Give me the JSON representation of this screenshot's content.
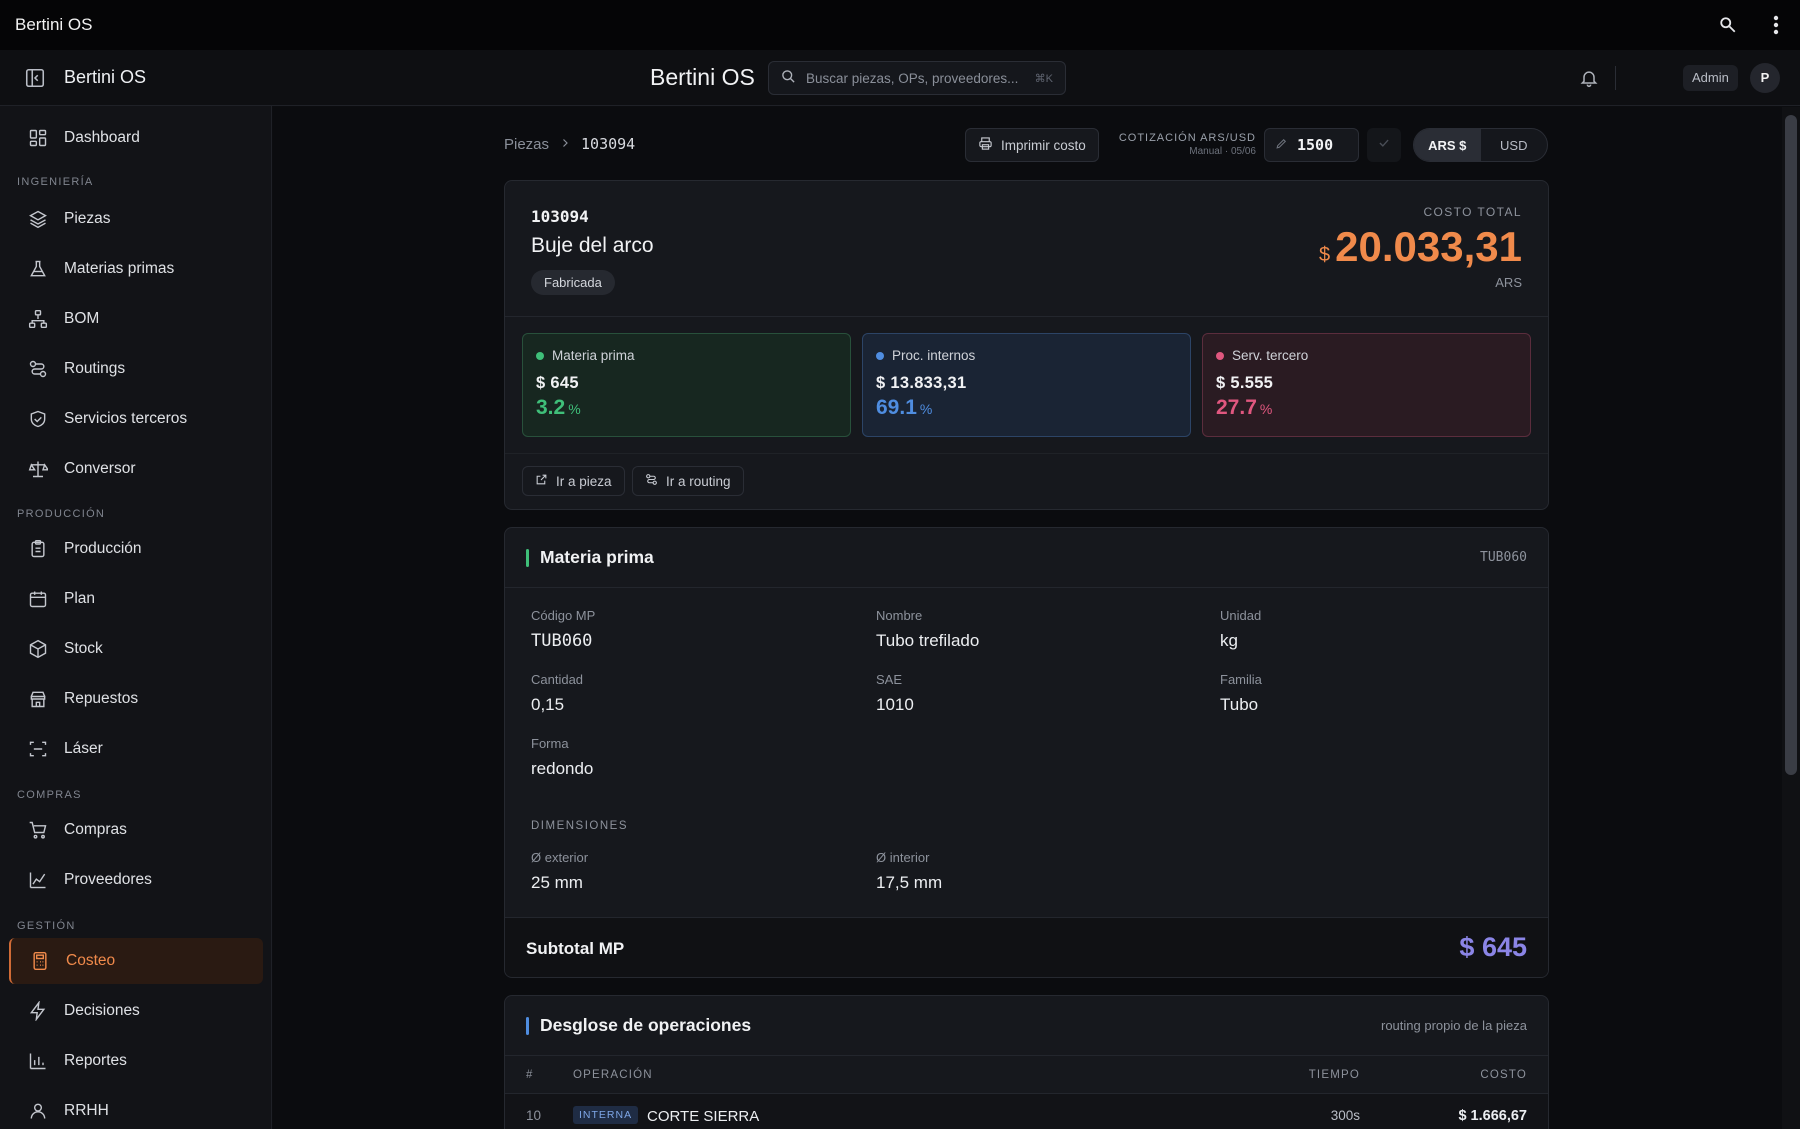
{
  "os": {
    "title": "Bertini OS"
  },
  "header": {
    "brand": "Bertini OS",
    "center_title": "Bertini OS",
    "search_placeholder": "Buscar piezas, OPs, proveedores...",
    "search_shortcut": "⌘K",
    "role": "Admin",
    "avatar_initial": "P"
  },
  "sidebar": {
    "items": [
      {
        "label": "Dashboard",
        "icon": "dashboard-icon"
      },
      {
        "section": "INGENIERÍA"
      },
      {
        "label": "Piezas",
        "icon": "layers-icon"
      },
      {
        "label": "Materias primas",
        "icon": "flask-icon"
      },
      {
        "label": "BOM",
        "icon": "tree-icon"
      },
      {
        "label": "Routings",
        "icon": "route-icon"
      },
      {
        "label": "Servicios terceros",
        "icon": "handshake-icon"
      },
      {
        "label": "Conversor",
        "icon": "scale-icon"
      },
      {
        "section": "PRODUCCIÓN"
      },
      {
        "label": "Producción",
        "icon": "clipboard-icon"
      },
      {
        "label": "Plan",
        "icon": "calendar-icon"
      },
      {
        "label": "Stock",
        "icon": "box-icon"
      },
      {
        "label": "Repuestos",
        "icon": "store-icon"
      },
      {
        "label": "Láser",
        "icon": "scan-icon"
      },
      {
        "section": "COMPRAS"
      },
      {
        "label": "Compras",
        "icon": "cart-icon"
      },
      {
        "label": "Proveedores",
        "icon": "factory-icon"
      },
      {
        "section": "GESTIÓN"
      },
      {
        "label": "Costeo",
        "icon": "calculator-icon",
        "active": true
      },
      {
        "label": "Decisiones",
        "icon": "bolt-icon"
      },
      {
        "label": "Reportes",
        "icon": "bar-chart-icon"
      },
      {
        "label": "RRHH",
        "icon": "user-icon"
      }
    ]
  },
  "breadcrumb": {
    "parent": "Piezas",
    "current": "103094"
  },
  "toolbar": {
    "print_label": "Imprimir costo",
    "rate_label": "COTIZACIÓN ARS/USD",
    "rate_sub": "Manual · 05/06",
    "rate_value": "1500",
    "currency_options": [
      "ARS $",
      "USD"
    ],
    "currency_selected": "ARS $"
  },
  "summary": {
    "code": "103094",
    "name": "Buje del arco",
    "type_tag": "Fabricada",
    "total_label": "COSTO TOTAL",
    "total_currency_symbol": "$",
    "total_value": "20.033,31",
    "total_unit": "ARS",
    "buckets": [
      {
        "label": "Materia prima",
        "value": "$ 645",
        "pct": "3.2",
        "pct_unit": "%",
        "color": "#3fbf79"
      },
      {
        "label": "Proc. internos",
        "value": "$ 13.833,31",
        "pct": "69.1",
        "pct_unit": "%",
        "color": "#4f8de0"
      },
      {
        "label": "Serv. tercero",
        "value": "$ 5.555",
        "pct": "27.7",
        "pct_unit": "%",
        "color": "#e0577f"
      }
    ],
    "links": [
      "Ir a pieza",
      "Ir a routing"
    ]
  },
  "materia_prima": {
    "title": "Materia prima",
    "code_right": "TUB060",
    "fields": {
      "codigo": {
        "label": "Código MP",
        "value": "TUB060"
      },
      "nombre": {
        "label": "Nombre",
        "value": "Tubo trefilado"
      },
      "unidad": {
        "label": "Unidad",
        "value": "kg"
      },
      "cantidad": {
        "label": "Cantidad",
        "value": "0,15"
      },
      "sae": {
        "label": "SAE",
        "value": "1010"
      },
      "familia": {
        "label": "Familia",
        "value": "Tubo"
      },
      "forma": {
        "label": "Forma",
        "value": "redondo"
      }
    },
    "dimensions_label": "DIMENSIONES",
    "dimensions": {
      "ext": {
        "label": "Ø exterior",
        "value": "25 mm"
      },
      "int": {
        "label": "Ø interior",
        "value": "17,5 mm"
      }
    },
    "subtotal_label": "Subtotal MP",
    "subtotal_value": "$ 645"
  },
  "operaciones": {
    "title": "Desglose de operaciones",
    "note": "routing propio de la pieza",
    "columns": [
      "#",
      "OPERACIÓN",
      "TIEMPO",
      "COSTO"
    ],
    "rows": [
      {
        "num": "10",
        "kind": "INTERNA",
        "name": "CORTE SIERRA",
        "time": "300s",
        "cost": "$ 1.666,67"
      }
    ]
  },
  "colors": {
    "accent": "#f08a4b",
    "mp": "#3fbf79",
    "proc": "#4f8de0",
    "terceros": "#e0577f",
    "subtotal": "#8b85e6"
  }
}
